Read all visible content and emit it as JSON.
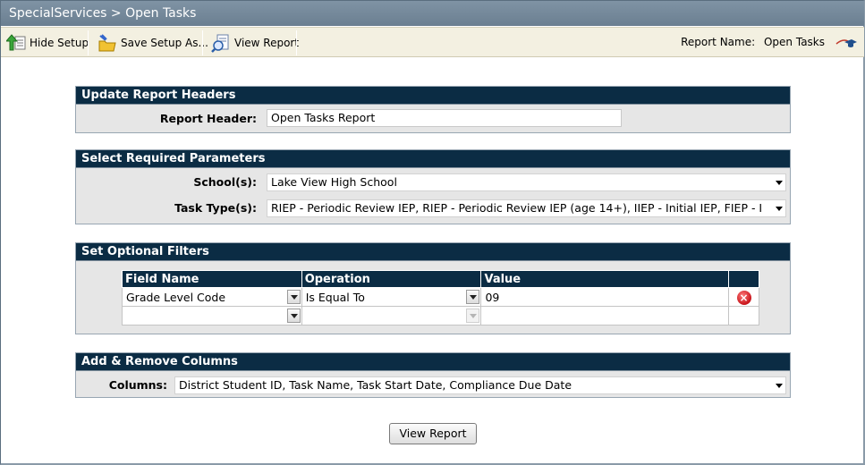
{
  "window": {
    "breadcrumb": "SpecialServices > Open Tasks"
  },
  "toolbar": {
    "hide_setup": "Hide Setup",
    "save_setup": "Save Setup As...",
    "view_report": "View Report",
    "report_name_label": "Report Name:",
    "report_name_value": "Open Tasks"
  },
  "headers_panel": {
    "title": "Update Report Headers",
    "report_header_label": "Report Header:",
    "report_header_value": "Open Tasks Report"
  },
  "params_panel": {
    "title": "Select Required Parameters",
    "schools_label": "School(s):",
    "schools_value": "Lake View High School",
    "task_types_label": "Task Type(s):",
    "task_types_value": "RIEP - Periodic Review IEP, RIEP - Periodic Review IEP (age 14+), IIEP - Initial IEP, FIEP - I"
  },
  "filters_panel": {
    "title": "Set Optional Filters",
    "columns": [
      "Field Name",
      "Operation",
      "Value"
    ],
    "rows": [
      {
        "field": "Grade Level Code",
        "operation": "Is Equal To",
        "value": "09"
      },
      {
        "field": "",
        "operation": "",
        "value": ""
      }
    ]
  },
  "columns_panel": {
    "title": "Add & Remove Columns",
    "columns_label": "Columns:",
    "columns_value": "District Student ID, Task Name, Task Start Date, Compliance Due Date"
  },
  "footer": {
    "view_report_button": "View Report"
  },
  "colors": {
    "panel_header": "#0b2c44",
    "titlebar": "#7489a0",
    "toolbar": "#f3f0e1",
    "panel_body": "#e6e6e6"
  }
}
